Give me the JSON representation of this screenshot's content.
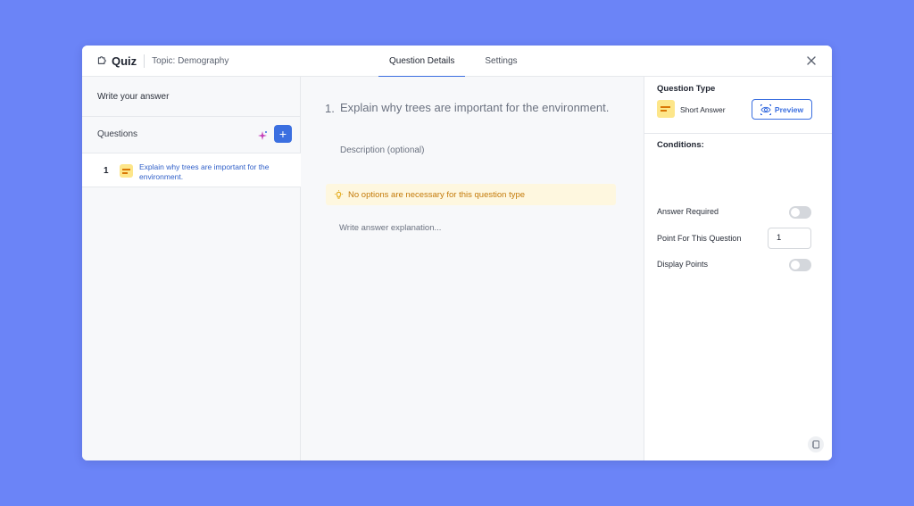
{
  "header": {
    "brand": "Quiz",
    "topic": "Topic: Demography",
    "tabs": [
      {
        "label": "Question Details",
        "active": true
      },
      {
        "label": "Settings",
        "active": false
      }
    ]
  },
  "sidebar": {
    "write_answer": "Write your answer",
    "questions_label": "Questions",
    "items": [
      {
        "number": "1",
        "text": "Explain why trees are important for the environment."
      }
    ]
  },
  "editor": {
    "question_number": "1.",
    "question_title": "Explain why trees are important for the environment.",
    "description_placeholder": "Description (optional)",
    "notice": "No options are necessary for this question type",
    "explanation_placeholder": "Write answer explanation..."
  },
  "settings_panel": {
    "question_type_label": "Question Type",
    "question_type": "Short Answer",
    "preview_label": "Preview",
    "conditions_label": "Conditions:",
    "answer_required_label": "Answer Required",
    "answer_required": false,
    "points_label": "Point For This Question",
    "points_value": "1",
    "display_points_label": "Display Points",
    "display_points": false
  },
  "colors": {
    "background": "#6b84f7",
    "accent": "#3b6fe0",
    "notice_bg": "#fef7df",
    "notice_text": "#c47a09",
    "type_icon": "#fde68a"
  },
  "icons": {
    "brand": "puzzle-icon",
    "close": "close-icon",
    "sparkle": "sparkle-icon",
    "add": "plus-icon",
    "notice": "lightbulb-icon",
    "preview": "eye-icon",
    "notes": "notes-icon"
  }
}
